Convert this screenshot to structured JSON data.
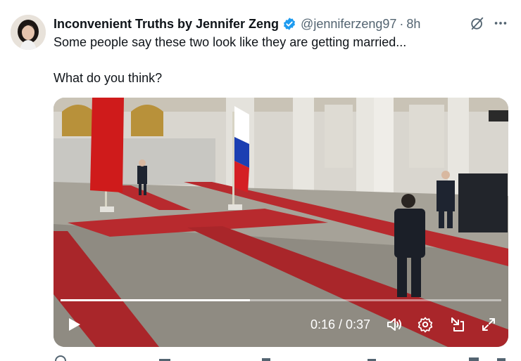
{
  "author": {
    "display_name": "Inconvenient Truths by Jennifer Zeng",
    "handle": "@jenniferzeng97",
    "separator": "·",
    "time_ago": "8h",
    "verified_icon": "verified-badge-icon",
    "avatar": "avatar-photo"
  },
  "tweet": {
    "line1": "Some people say these two look like they are getting married...",
    "line2": "What do you think?"
  },
  "video": {
    "current_time": "0:16",
    "duration": "0:37",
    "time_display": "0:16 / 0:37",
    "progress_fraction": 0.43,
    "icons": [
      "play-icon",
      "volume-icon",
      "settings-icon",
      "dock-icon",
      "fullscreen-icon"
    ]
  },
  "colors": {
    "text_primary": "#0f1419",
    "text_secondary": "#536471",
    "verified_blue": "#1d9bf0",
    "carpet_red": "#b82a2e"
  }
}
